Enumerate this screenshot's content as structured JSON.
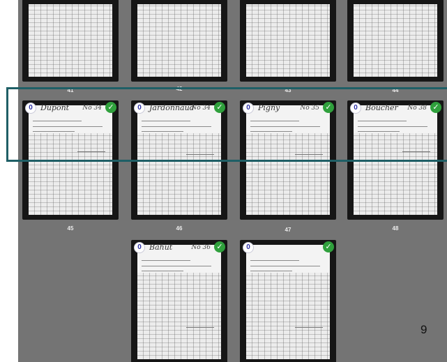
{
  "viewer": {
    "page_number": "9",
    "thumbnails": [
      {
        "label": "41",
        "handwriting": "",
        "handwriting_right": ""
      },
      {
        "label": "42",
        "handwriting": "",
        "handwriting_right": ""
      },
      {
        "label": "43",
        "handwriting": "",
        "handwriting_right": ""
      },
      {
        "label": "44",
        "handwriting": "",
        "handwriting_right": ""
      },
      {
        "label": "45",
        "badge": "0",
        "handwriting": "Dupont",
        "handwriting_right": "No 34"
      },
      {
        "label": "46",
        "badge": "0",
        "handwriting": "Jardonnaud",
        "handwriting_right": "No 34"
      },
      {
        "label": "47",
        "badge": "0",
        "handwriting": "Pigny",
        "handwriting_right": "No 35"
      },
      {
        "label": "48",
        "badge": "0",
        "handwriting": "Boucher",
        "handwriting_right": "No 38"
      },
      {
        "label": "",
        "badge": "0",
        "handwriting": "Bahut",
        "handwriting_right": "No 36"
      },
      {
        "label": "",
        "badge": "0",
        "handwriting": "",
        "handwriting_right": ""
      }
    ]
  },
  "colors": {
    "viewer_bg": "#747474",
    "selection_border": "#1f5f66",
    "check_green": "#2fa03c",
    "badge_text": "#2b2fa6"
  },
  "icons": {
    "checked": "check-circle-icon"
  }
}
